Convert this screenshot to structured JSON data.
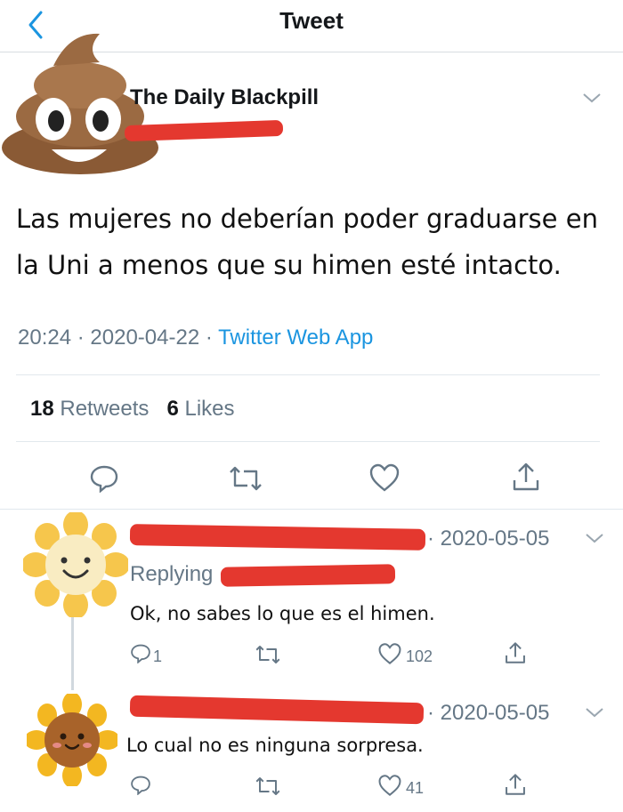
{
  "header": {
    "title": "Tweet"
  },
  "tweet": {
    "author_name": "The Daily Blackpill",
    "text": "Las mujeres no deberían poder graduarse en la Uni a menos que su himen esté intacto.",
    "time": "20:24",
    "date": "2020-04-22",
    "source": "Twitter Web App",
    "retweets_count": "18",
    "retweets_label": "Retweets",
    "likes_count": "6",
    "likes_label": "Likes"
  },
  "replies": [
    {
      "date": "· 2020-05-05",
      "replying_label": "Replying",
      "text": "Ok, no sabes lo que es el himen.",
      "reply_count": "1",
      "like_count": "102"
    },
    {
      "date": "· 2020-05-05",
      "text": "Lo cual no es ninguna sorpresa.",
      "like_count": "41"
    }
  ],
  "colors": {
    "accent": "#1b95e0",
    "muted": "#657786",
    "redaction": "#e4382f"
  }
}
